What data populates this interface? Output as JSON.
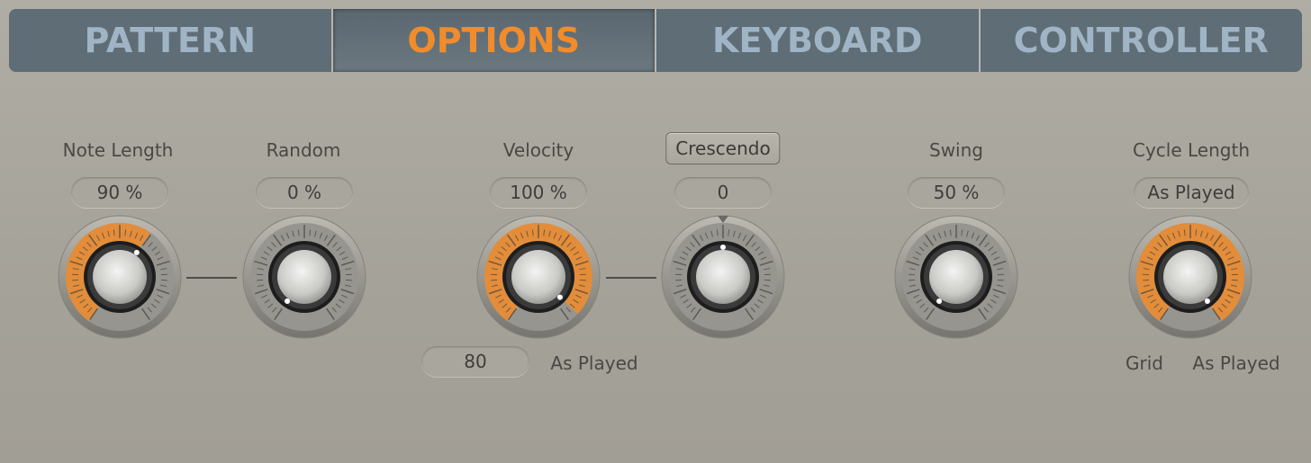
{
  "tabs": [
    {
      "label": "PATTERN",
      "active": false
    },
    {
      "label": "OPTIONS",
      "active": true
    },
    {
      "label": "KEYBOARD",
      "active": false
    },
    {
      "label": "CONTROLLER",
      "active": false
    }
  ],
  "colors": {
    "accent": "#f08c2c",
    "tab_bg": "#5f6d76",
    "tab_text": "#9fb4c4",
    "panel": "#a9a69d"
  },
  "controls": {
    "note_length": {
      "label": "Note Length",
      "value": "90 %",
      "position": 0.62,
      "lit": true
    },
    "random": {
      "label": "Random",
      "value": "0 %",
      "position": 0.0,
      "lit": false
    },
    "velocity": {
      "label": "Velocity",
      "value": "100 %",
      "position": 0.96,
      "lit": true,
      "min_value": "80",
      "max_label": "As Played"
    },
    "crescendo": {
      "label": "Crescendo",
      "value": "0",
      "position": 0.5,
      "lit": false
    },
    "swing": {
      "label": "Swing",
      "value": "50 %",
      "position": 0.0,
      "lit": false
    },
    "cycle_length": {
      "label": "Cycle Length",
      "value": "As Played",
      "position": 1.0,
      "lit": true,
      "min_label": "Grid",
      "max_label": "As Played"
    }
  }
}
